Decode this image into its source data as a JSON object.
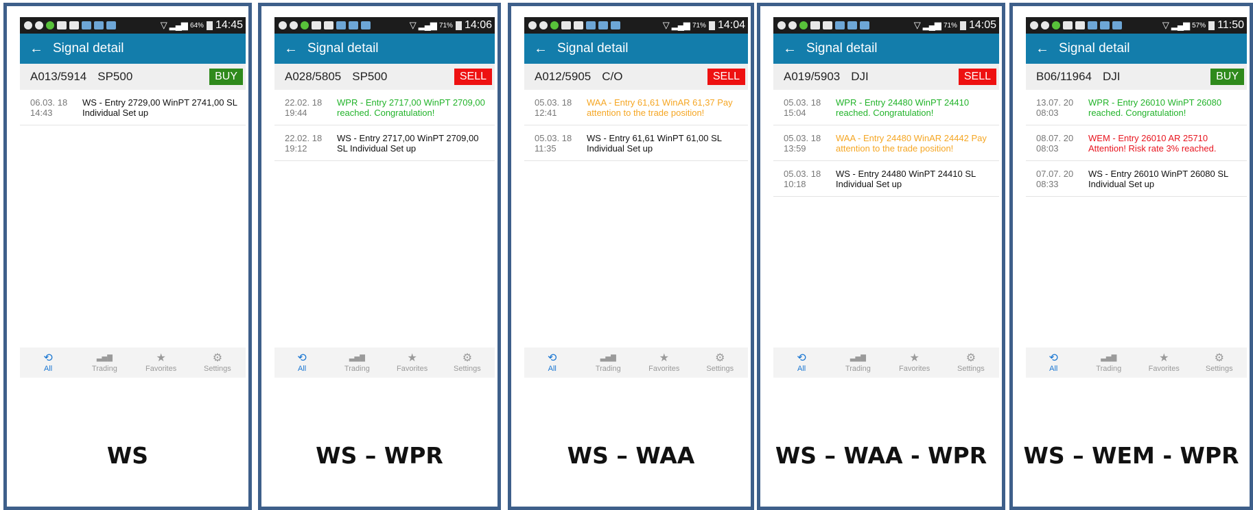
{
  "app": {
    "title": "Signal detail"
  },
  "nav": [
    "All",
    "Trading",
    "Favorites",
    "Settings"
  ],
  "colors": {
    "ws": "#111111",
    "wpr": "#22b32a",
    "waa": "#f5a623",
    "wem": "#e8141e",
    "buy": "#2f8a1c",
    "sell": "#ee1111",
    "appbar": "#137dab"
  },
  "panels": [
    {
      "caption": "WS",
      "status": {
        "battery": "64%",
        "time": "14:45"
      },
      "code": "A013/5914",
      "symbol": "SP500",
      "action": "BUY",
      "rows": [
        {
          "date": "06.03. 18",
          "time": "14:43",
          "text": "WS - Entry 2729,00 WinPT 2741,00 SL Individual Set up",
          "kind": "ws"
        }
      ]
    },
    {
      "caption": "WS – WPR",
      "status": {
        "battery": "71%",
        "time": "14:06"
      },
      "code": "A028/5805",
      "symbol": "SP500",
      "action": "SELL",
      "rows": [
        {
          "date": "22.02. 18",
          "time": "19:44",
          "text": "WPR - Entry 2717,00 WinPT 2709,00 reached. Congratulation!",
          "kind": "wpr"
        },
        {
          "date": "22.02. 18",
          "time": "19:12",
          "text": "WS - Entry 2717,00 WinPT 2709,00 SL Individual Set up",
          "kind": "ws"
        }
      ]
    },
    {
      "caption": "WS – WAA",
      "status": {
        "battery": "71%",
        "time": "14:04"
      },
      "code": "A012/5905",
      "symbol": "C/O",
      "action": "SELL",
      "rows": [
        {
          "date": "05.03. 18",
          "time": "12:41",
          "text": "WAA - Entry 61,61 WinAR 61,37 Pay attention to the trade position!",
          "kind": "waa"
        },
        {
          "date": "05.03. 18",
          "time": "11:35",
          "text": "WS - Entry 61,61 WinPT 61,00 SL Individual Set up",
          "kind": "ws"
        }
      ]
    },
    {
      "caption": "WS – WAA - WPR",
      "status": {
        "battery": "71%",
        "time": "14:05"
      },
      "code": "A019/5903",
      "symbol": "DJI",
      "action": "SELL",
      "rows": [
        {
          "date": "05.03. 18",
          "time": "15:04",
          "text": "WPR - Entry 24480 WinPT 24410 reached. Congratulation!",
          "kind": "wpr"
        },
        {
          "date": "05.03. 18",
          "time": "13:59",
          "text": "WAA - Entry 24480 WinAR 24442 Pay attention to the trade position!",
          "kind": "waa"
        },
        {
          "date": "05.03. 18",
          "time": "10:18",
          "text": "WS - Entry 24480 WinPT 24410 SL Individual Set up",
          "kind": "ws"
        }
      ]
    },
    {
      "caption": "WS – WEM - WPR",
      "status": {
        "battery": "57%",
        "time": "11:50"
      },
      "code": "B06/11964",
      "symbol": "DJI",
      "action": "BUY",
      "rows": [
        {
          "date": "13.07. 20",
          "time": "08:03",
          "text": "WPR - Entry 26010 WinPT 26080 reached. Congratulation!",
          "kind": "wpr"
        },
        {
          "date": "08.07. 20",
          "time": "08:03",
          "text": "WEM - Entry 26010 AR 25710 Attention! Risk rate 3% reached.",
          "kind": "wem"
        },
        {
          "date": "07.07. 20",
          "time": "08:33",
          "text": "WS - Entry 26010 WinPT 26080 SL Individual Set up",
          "kind": "ws"
        }
      ]
    }
  ]
}
